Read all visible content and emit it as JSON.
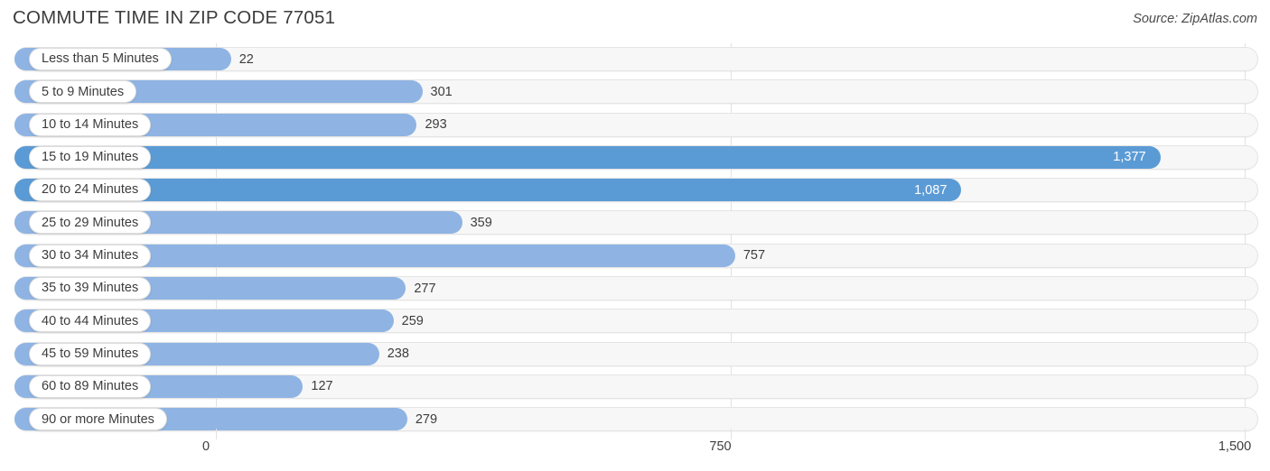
{
  "header": {
    "title": "COMMUTE TIME IN ZIP CODE 77051",
    "source": "Source: ZipAtlas.com"
  },
  "colors": {
    "bar_light": "#8fb4e3",
    "bar_dark": "#5b9bd5",
    "track": "#f7f7f7",
    "track_border": "#e4e4e4",
    "gridline": "#e2e2e2",
    "text": "#3d3d3d",
    "value_inside": "#ffffff"
  },
  "chart_data": {
    "type": "bar",
    "orientation": "horizontal",
    "title": "COMMUTE TIME IN ZIP CODE 77051",
    "subtitle": "",
    "xlabel": "",
    "ylabel": "",
    "xlim": [
      0,
      1500
    ],
    "grid": true,
    "legend": false,
    "xticks": [
      0,
      750,
      1500
    ],
    "xtick_labels": [
      "0",
      "750",
      "1,500"
    ],
    "categories": [
      "Less than 5 Minutes",
      "5 to 9 Minutes",
      "10 to 14 Minutes",
      "15 to 19 Minutes",
      "20 to 24 Minutes",
      "25 to 29 Minutes",
      "30 to 34 Minutes",
      "35 to 39 Minutes",
      "40 to 44 Minutes",
      "45 to 59 Minutes",
      "60 to 89 Minutes",
      "90 or more Minutes"
    ],
    "values": [
      22,
      301,
      293,
      1377,
      1087,
      359,
      757,
      277,
      259,
      238,
      127,
      279
    ],
    "value_labels": [
      "22",
      "301",
      "293",
      "1,377",
      "1,087",
      "359",
      "757",
      "277",
      "259",
      "238",
      "127",
      "279"
    ]
  },
  "rows": [
    {
      "label": "Less than 5 Minutes",
      "value": 22,
      "value_label": "22",
      "highlight": false,
      "label_inside": false
    },
    {
      "label": "5 to 9 Minutes",
      "value": 301,
      "value_label": "301",
      "highlight": false,
      "label_inside": false
    },
    {
      "label": "10 to 14 Minutes",
      "value": 293,
      "value_label": "293",
      "highlight": false,
      "label_inside": false
    },
    {
      "label": "15 to 19 Minutes",
      "value": 1377,
      "value_label": "1,377",
      "highlight": true,
      "label_inside": true
    },
    {
      "label": "20 to 24 Minutes",
      "value": 1087,
      "value_label": "1,087",
      "highlight": true,
      "label_inside": true
    },
    {
      "label": "25 to 29 Minutes",
      "value": 359,
      "value_label": "359",
      "highlight": false,
      "label_inside": false
    },
    {
      "label": "30 to 34 Minutes",
      "value": 757,
      "value_label": "757",
      "highlight": false,
      "label_inside": false
    },
    {
      "label": "35 to 39 Minutes",
      "value": 277,
      "value_label": "277",
      "highlight": false,
      "label_inside": false
    },
    {
      "label": "40 to 44 Minutes",
      "value": 259,
      "value_label": "259",
      "highlight": false,
      "label_inside": false
    },
    {
      "label": "45 to 59 Minutes",
      "value": 238,
      "value_label": "238",
      "highlight": false,
      "label_inside": false
    },
    {
      "label": "60 to 89 Minutes",
      "value": 127,
      "value_label": "127",
      "highlight": false,
      "label_inside": false
    },
    {
      "label": "90 or more Minutes",
      "value": 279,
      "value_label": "279",
      "highlight": false,
      "label_inside": false
    }
  ],
  "axis": {
    "ticks": [
      {
        "label": "0",
        "value": 0
      },
      {
        "label": "750",
        "value": 750
      },
      {
        "label": "1,500",
        "value": 1500
      }
    ]
  }
}
